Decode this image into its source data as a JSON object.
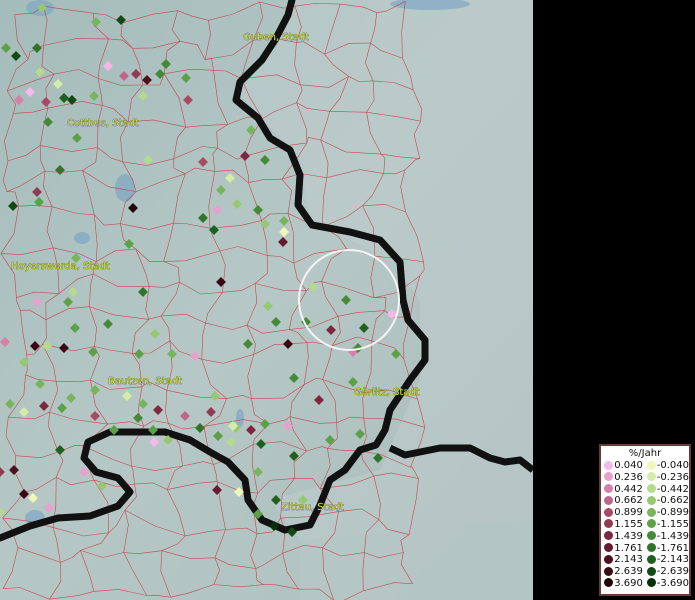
{
  "map": {
    "cities": [
      {
        "name": "Guben, Stadt"
      },
      {
        "name": "Cottbus, Stadt"
      },
      {
        "name": "Hoyerswerda, Stadt"
      },
      {
        "name": "Bautzen, Stadt"
      },
      {
        "name": "Görlitz, Stadt"
      },
      {
        "name": "Zittau, Stadt"
      }
    ]
  },
  "legend": {
    "title": "%/Jahr",
    "positive": [
      {
        "value": "0.040",
        "color": "#f4b8ec"
      },
      {
        "value": "0.236",
        "color": "#e8a0cc"
      },
      {
        "value": "0.442",
        "color": "#d680a8"
      },
      {
        "value": "0.662",
        "color": "#c06688"
      },
      {
        "value": "0.899",
        "color": "#a84a66"
      },
      {
        "value": "1.155",
        "color": "#923a54"
      },
      {
        "value": "1.439",
        "color": "#7c2840"
      },
      {
        "value": "1.761",
        "color": "#661a30"
      },
      {
        "value": "2.143",
        "color": "#501020"
      },
      {
        "value": "2.639",
        "color": "#3a0814"
      },
      {
        "value": "3.690",
        "color": "#24020a"
      }
    ],
    "negative": [
      {
        "value": "-0.040",
        "color": "#f0f8b8"
      },
      {
        "value": "-0.236",
        "color": "#d4eca8"
      },
      {
        "value": "-0.442",
        "color": "#b4da8c"
      },
      {
        "value": "-0.662",
        "color": "#96c874"
      },
      {
        "value": "-0.899",
        "color": "#78b45c"
      },
      {
        "value": "-1.155",
        "color": "#5ca048"
      },
      {
        "value": "-1.439",
        "color": "#448a38"
      },
      {
        "value": "-1.761",
        "color": "#30742a"
      },
      {
        "value": "-2.143",
        "color": "#20601e"
      },
      {
        "value": "-2.639",
        "color": "#124a12"
      },
      {
        "value": "-3.690",
        "color": "#063006"
      }
    ]
  }
}
